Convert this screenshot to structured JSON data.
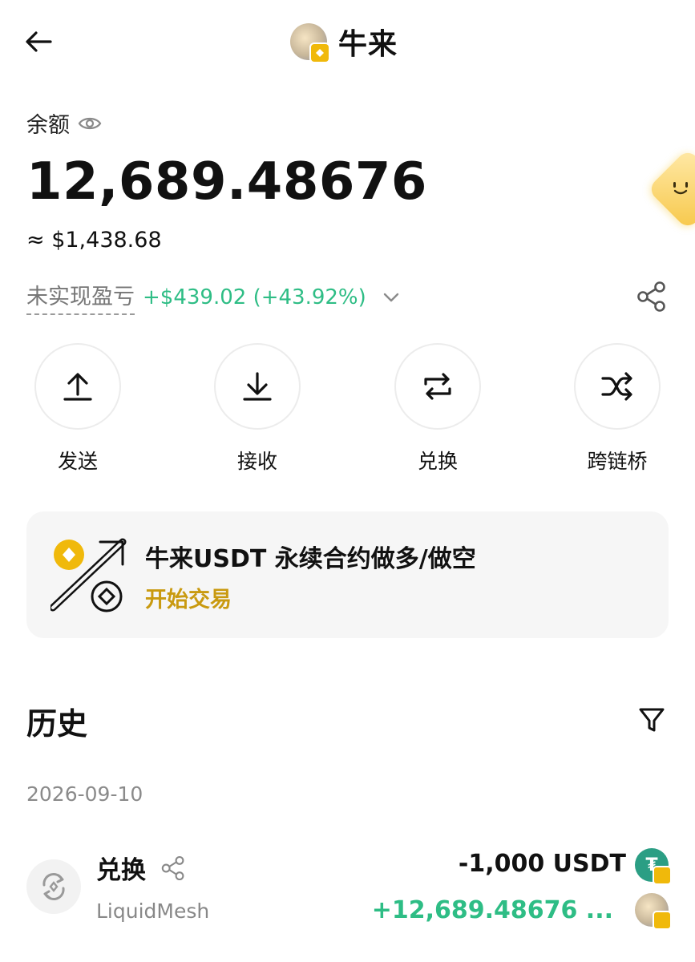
{
  "header": {
    "title": "牛来",
    "back_icon": "arrow-left-icon",
    "avatar_icon": "token-avatar"
  },
  "balance": {
    "label": "余额",
    "amount": "12,689.48676",
    "usd_value": "≈ $1,438.68",
    "pnl_label": "未实现盈亏",
    "pnl_value": "+$439.02 (+43.92%)",
    "pnl_color": "#2ebd85"
  },
  "actions": [
    {
      "label": "发送",
      "icon": "upload-arrow-icon"
    },
    {
      "label": "接收",
      "icon": "download-arrow-icon"
    },
    {
      "label": "兑换",
      "icon": "swap-arrows-icon"
    },
    {
      "label": "跨链桥",
      "icon": "shuffle-icon"
    }
  ],
  "promo": {
    "title": "牛来USDT 永续合约做多/做空",
    "cta": "开始交易",
    "cta_color": "#c99a10"
  },
  "history": {
    "title": "历史",
    "date": "2026-09-10",
    "transactions": [
      {
        "type": "兑换",
        "source": "LiquidMesh",
        "amount_out": "-1,000 USDT",
        "amount_in": "+12,689.48676 ...",
        "in_color": "#2ebd85"
      }
    ]
  },
  "colors": {
    "accent": "#f0b90b",
    "positive": "#2ebd85",
    "muted": "#888888"
  }
}
